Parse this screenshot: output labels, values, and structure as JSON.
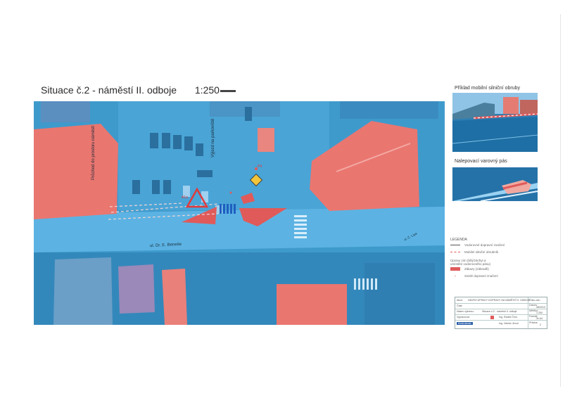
{
  "title": {
    "text": "Situace č.2 - náměstí II. odboje",
    "scale": "1:250"
  },
  "map": {
    "labels": {
      "crossing": "Průchod do prostoru náměstí",
      "parking_exit": "Výjezd na parkoviště",
      "street": "ul. Dr. E. Beneše",
      "street_right": "ul. Č. Lípa",
      "sign_a": "A1a",
      "sign_b": "P4"
    }
  },
  "photos": [
    {
      "caption": "Příklad mobilní silniční obruby"
    },
    {
      "caption": "Nalepovací varovný pás"
    }
  ],
  "legend": {
    "title": "LEGENDA",
    "items": [
      {
        "label": "Vodorovné dopravní značení"
      },
      {
        "label": "Mobilní silniční obrubník"
      },
      {
        "label": "Úpravy zón (bílý/záchyt a umístění vodorovného pásu)"
      },
      {
        "label": "Zákazy (zábradlí)"
      },
      {
        "label": "Svislé dopravní značení"
      }
    ]
  },
  "title_block": {
    "rows": [
      {
        "label": "Akce:",
        "value": "NÁVRH ÚPRAVY DOPRAVY NA NÁMĚSTÍ II. ODBOJE",
        "right_label": "Číslo zak.:",
        "right_value": ""
      },
      {
        "label": "Část:",
        "value": "",
        "right_label": "Datum:",
        "right_value": "08/2013"
      },
      {
        "label": "Název výkresu:",
        "value": "Situace č.2 - náměstí II. odboje",
        "right_label": "Měřítko:",
        "right_value": "1:250"
      },
      {
        "label": "Vypracoval:",
        "value": "Ing. Radek Čero",
        "right_label": "Formát:",
        "right_value": "3x A4"
      },
      {
        "label": "Kontroloval:",
        "value": "Ing. Václav Jirout",
        "right_label": "Příloha:",
        "right_value": "2"
      }
    ]
  },
  "colors": {
    "map_blue": "#3d97c9",
    "roof_red": "#ea7670",
    "marking_red": "#e05a5a"
  }
}
